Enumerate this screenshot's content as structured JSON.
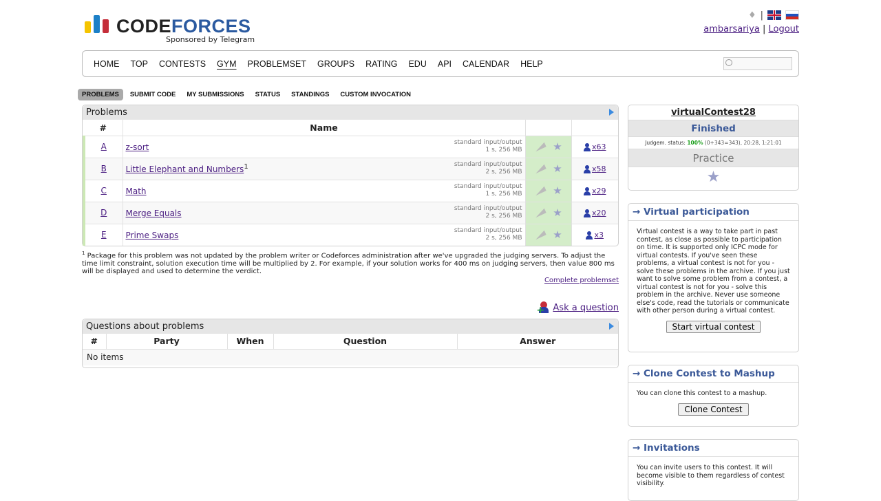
{
  "header": {
    "logo_code": "CODE",
    "logo_forces": "FORCES",
    "sponsor": "Sponsored by Telegram",
    "separator": "|",
    "username": "ambarsariya",
    "logout": "Logout",
    "bar_colors": [
      "#f5c400",
      "#1c80c7",
      "#c52e3a"
    ]
  },
  "menu": {
    "items": [
      "HOME",
      "TOP",
      "CONTESTS",
      "GYM",
      "PROBLEMSET",
      "GROUPS",
      "RATING",
      "EDU",
      "API",
      "CALENDAR",
      "HELP"
    ],
    "active": "GYM",
    "search_placeholder": ""
  },
  "submenu": {
    "items": [
      "PROBLEMS",
      "SUBMIT CODE",
      "MY SUBMISSIONS",
      "STATUS",
      "STANDINGS",
      "CUSTOM INVOCATION"
    ],
    "active": "PROBLEMS"
  },
  "problems": {
    "title": "Problems",
    "col_index": "#",
    "col_name": "Name",
    "rows": [
      {
        "index": "A",
        "name": "z-sort",
        "sup": "",
        "io": "standard input/output",
        "limits": "1 s, 256 MB",
        "solved": "x63"
      },
      {
        "index": "B",
        "name": "Little Elephant and Numbers",
        "sup": "1",
        "io": "standard input/output",
        "limits": "2 s, 256 MB",
        "solved": "x58"
      },
      {
        "index": "C",
        "name": "Math",
        "sup": "",
        "io": "standard input/output",
        "limits": "1 s, 256 MB",
        "solved": "x29"
      },
      {
        "index": "D",
        "name": "Merge Equals",
        "sup": "",
        "io": "standard input/output",
        "limits": "2 s, 256 MB",
        "solved": "x20"
      },
      {
        "index": "E",
        "name": "Prime Swaps",
        "sup": "",
        "io": "standard input/output",
        "limits": "2 s, 256 MB",
        "solved": "x3"
      }
    ]
  },
  "footnote": {
    "mark": "1",
    "text": "Package for this problem was not updated by the problem writer or Codeforces administration after we've upgraded the judging servers. To adjust the time limit constraint, solution execution time will be multiplied by 2. For example, if your solution works for 400 ms on judging servers, then value 800 ms will be displayed and used to determine the verdict."
  },
  "complete_problemset": "Complete problemset",
  "ask_question": "Ask a question",
  "questions": {
    "title": "Questions about problems",
    "columns": [
      "#",
      "Party",
      "When",
      "Question",
      "Answer"
    ],
    "empty": "No items"
  },
  "contest": {
    "name": "virtualContest28",
    "status": "Finished",
    "judge_label": "Judgem. status:",
    "judge_pct": "100%",
    "judge_detail": "(0+343=343), 20:28, 1:21:01",
    "phase": "Practice"
  },
  "virtual": {
    "title": "→ Virtual participation",
    "body": "Virtual contest is a way to take part in past contest, as close as possible to participation on time. It is supported only ICPC mode for virtual contests. If you've seen these problems, a virtual contest is not for you - solve these problems in the archive. If you just want to solve some problem from a contest, a virtual contest is not for you - solve this problem in the archive. Never use someone else's code, read the tutorials or communicate with other person during a virtual contest.",
    "button": "Start virtual contest"
  },
  "clone": {
    "title": "→ Clone Contest to Mashup",
    "body": "You can clone this contest to a mashup.",
    "button": "Clone Contest"
  },
  "invite": {
    "title": "→ Invitations",
    "body": "You can invite users to this contest. It will become visible to them regardless of contest visibility."
  }
}
